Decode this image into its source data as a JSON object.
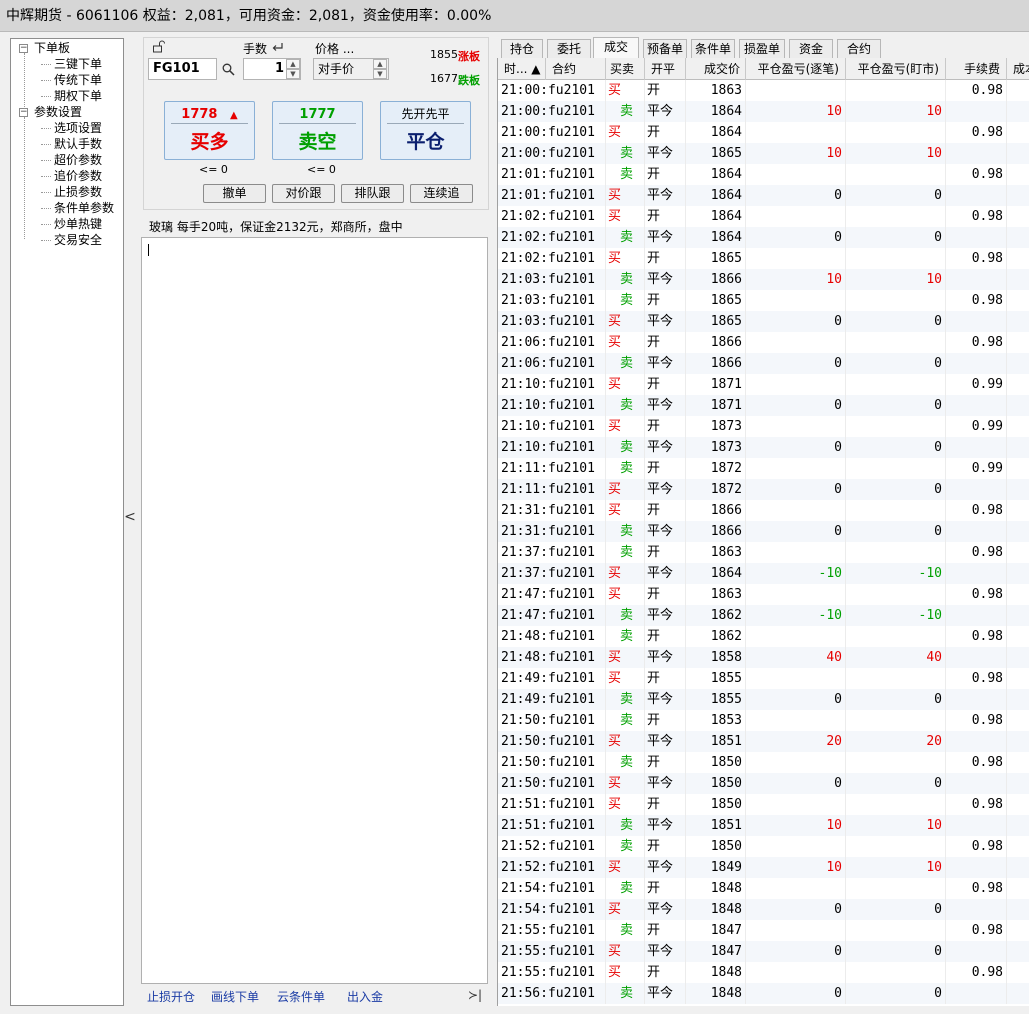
{
  "window": {
    "title": "中辉期货 - 6061106  权益：2,081，可用资金：2,081，资金使用率：0.00%"
  },
  "tree": {
    "groups": [
      {
        "label": "下单板",
        "children": [
          "三键下单",
          "传统下单",
          "期权下单"
        ]
      },
      {
        "label": "参数设置",
        "children": [
          "选项设置",
          "默认手数",
          "超价参数",
          "追价参数",
          "止损参数",
          "条件单参数",
          "炒单热键",
          "交易安全"
        ]
      }
    ]
  },
  "order": {
    "lots_label": "手数",
    "price_label": "价格 ...",
    "symbol": "FG101",
    "lots": "1",
    "price_mode": "对手价",
    "limit_up_price": "1855",
    "limit_up_label": "涨板",
    "limit_down_price": "1677",
    "limit_down_label": "跌板",
    "buy": {
      "price": "1778",
      "label": "买多",
      "sub": "<= 0"
    },
    "sell": {
      "price": "1777",
      "label": "卖空",
      "sub": "<= 0"
    },
    "close": {
      "top": "先开先平",
      "label": "平仓"
    },
    "buttons": [
      "撤单",
      "对价跟",
      "排队跟",
      "连续追"
    ]
  },
  "info": "玻璃  每手20吨，保证金2132元，郑商所，盘中",
  "bottom_links": [
    "止损开仓",
    "画线下单",
    "云条件单",
    "出入金"
  ],
  "bottom_expand": "≻|",
  "tabs": [
    "持仓",
    "委托",
    "成交",
    "预备单",
    "条件单",
    "损盈单",
    "资金",
    "合约"
  ],
  "active_tab": 2,
  "colors": {
    "buy": "#e60000",
    "sell": "#00a000",
    "text": "#000000",
    "accent": "#1b3ca5"
  },
  "columns": [
    "时... ▲",
    "合约",
    "买卖",
    "开平",
    "成交价",
    "平仓盈亏(逐笔)",
    "平仓盈亏(盯市)",
    "手续费",
    "成本"
  ],
  "rows": [
    [
      "21:00:fu2101",
      "买",
      "开",
      "1863",
      "",
      "",
      "0.98"
    ],
    [
      "21:00:fu2101",
      "卖",
      "平今",
      "1864",
      "10",
      "10",
      ""
    ],
    [
      "21:00:fu2101",
      "买",
      "开",
      "1864",
      "",
      "",
      "0.98"
    ],
    [
      "21:00:fu2101",
      "卖",
      "平今",
      "1865",
      "10",
      "10",
      ""
    ],
    [
      "21:01:fu2101",
      "卖",
      "开",
      "1864",
      "",
      "",
      "0.98"
    ],
    [
      "21:01:fu2101",
      "买",
      "平今",
      "1864",
      "0",
      "0",
      ""
    ],
    [
      "21:02:fu2101",
      "买",
      "开",
      "1864",
      "",
      "",
      "0.98"
    ],
    [
      "21:02:fu2101",
      "卖",
      "平今",
      "1864",
      "0",
      "0",
      ""
    ],
    [
      "21:02:fu2101",
      "买",
      "开",
      "1865",
      "",
      "",
      "0.98"
    ],
    [
      "21:03:fu2101",
      "卖",
      "平今",
      "1866",
      "10",
      "10",
      ""
    ],
    [
      "21:03:fu2101",
      "卖",
      "开",
      "1865",
      "",
      "",
      "0.98"
    ],
    [
      "21:03:fu2101",
      "买",
      "平今",
      "1865",
      "0",
      "0",
      ""
    ],
    [
      "21:06:fu2101",
      "买",
      "开",
      "1866",
      "",
      "",
      "0.98"
    ],
    [
      "21:06:fu2101",
      "卖",
      "平今",
      "1866",
      "0",
      "0",
      ""
    ],
    [
      "21:10:fu2101",
      "买",
      "开",
      "1871",
      "",
      "",
      "0.99"
    ],
    [
      "21:10:fu2101",
      "卖",
      "平今",
      "1871",
      "0",
      "0",
      ""
    ],
    [
      "21:10:fu2101",
      "买",
      "开",
      "1873",
      "",
      "",
      "0.99"
    ],
    [
      "21:10:fu2101",
      "卖",
      "平今",
      "1873",
      "0",
      "0",
      ""
    ],
    [
      "21:11:fu2101",
      "卖",
      "开",
      "1872",
      "",
      "",
      "0.99"
    ],
    [
      "21:11:fu2101",
      "买",
      "平今",
      "1872",
      "0",
      "0",
      ""
    ],
    [
      "21:31:fu2101",
      "买",
      "开",
      "1866",
      "",
      "",
      "0.98"
    ],
    [
      "21:31:fu2101",
      "卖",
      "平今",
      "1866",
      "0",
      "0",
      ""
    ],
    [
      "21:37:fu2101",
      "卖",
      "开",
      "1863",
      "",
      "",
      "0.98"
    ],
    [
      "21:37:fu2101",
      "买",
      "平今",
      "1864",
      "-10",
      "-10",
      ""
    ],
    [
      "21:47:fu2101",
      "买",
      "开",
      "1863",
      "",
      "",
      "0.98"
    ],
    [
      "21:47:fu2101",
      "卖",
      "平今",
      "1862",
      "-10",
      "-10",
      ""
    ],
    [
      "21:48:fu2101",
      "卖",
      "开",
      "1862",
      "",
      "",
      "0.98"
    ],
    [
      "21:48:fu2101",
      "买",
      "平今",
      "1858",
      "40",
      "40",
      ""
    ],
    [
      "21:49:fu2101",
      "买",
      "开",
      "1855",
      "",
      "",
      "0.98"
    ],
    [
      "21:49:fu2101",
      "卖",
      "平今",
      "1855",
      "0",
      "0",
      ""
    ],
    [
      "21:50:fu2101",
      "卖",
      "开",
      "1853",
      "",
      "",
      "0.98"
    ],
    [
      "21:50:fu2101",
      "买",
      "平今",
      "1851",
      "20",
      "20",
      ""
    ],
    [
      "21:50:fu2101",
      "卖",
      "开",
      "1850",
      "",
      "",
      "0.98"
    ],
    [
      "21:50:fu2101",
      "买",
      "平今",
      "1850",
      "0",
      "0",
      ""
    ],
    [
      "21:51:fu2101",
      "买",
      "开",
      "1850",
      "",
      "",
      "0.98"
    ],
    [
      "21:51:fu2101",
      "卖",
      "平今",
      "1851",
      "10",
      "10",
      ""
    ],
    [
      "21:52:fu2101",
      "卖",
      "开",
      "1850",
      "",
      "",
      "0.98"
    ],
    [
      "21:52:fu2101",
      "买",
      "平今",
      "1849",
      "10",
      "10",
      ""
    ],
    [
      "21:54:fu2101",
      "卖",
      "开",
      "1848",
      "",
      "",
      "0.98"
    ],
    [
      "21:54:fu2101",
      "买",
      "平今",
      "1848",
      "0",
      "0",
      ""
    ],
    [
      "21:55:fu2101",
      "卖",
      "开",
      "1847",
      "",
      "",
      "0.98"
    ],
    [
      "21:55:fu2101",
      "买",
      "平今",
      "1847",
      "0",
      "0",
      ""
    ],
    [
      "21:55:fu2101",
      "买",
      "开",
      "1848",
      "",
      "",
      "0.98"
    ],
    [
      "21:56:fu2101",
      "卖",
      "平今",
      "1848",
      "0",
      "0",
      ""
    ]
  ]
}
